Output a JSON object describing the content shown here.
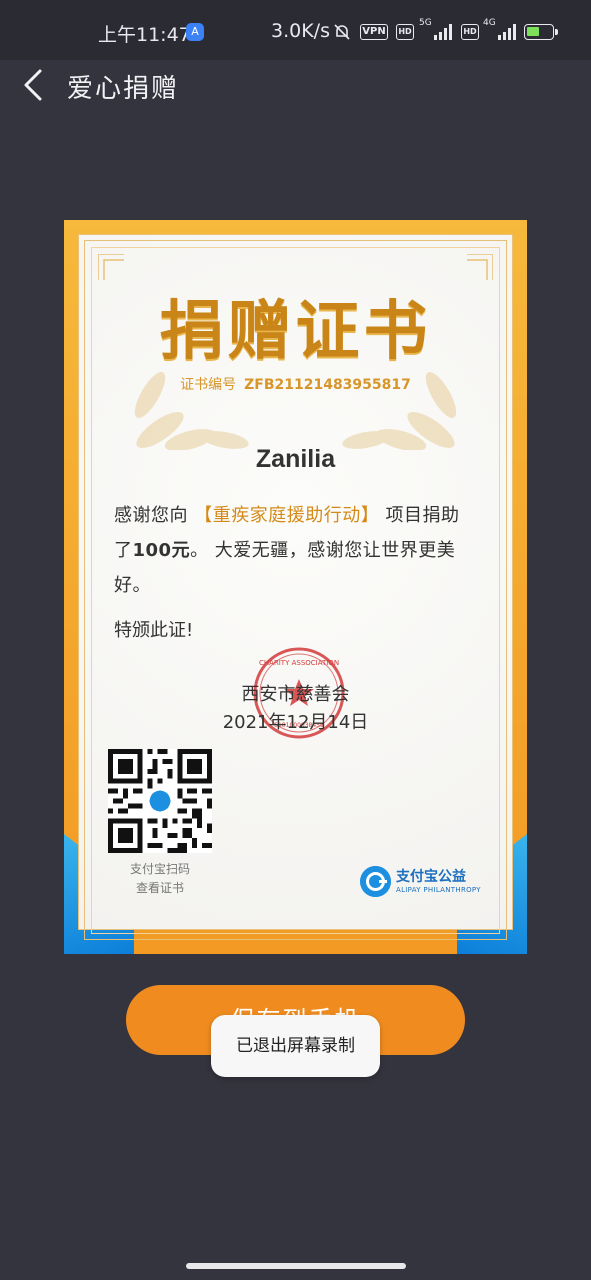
{
  "status_bar": {
    "time": "上午11:47",
    "app_badge": "A",
    "network_speed": "3.0K/s",
    "vpn": "VPN",
    "hd": "HD",
    "sig1": "5G",
    "sig2": "4G",
    "battery_level": 0.5
  },
  "header": {
    "title": "爱心捐赠",
    "back_icon": "chevron-left-icon"
  },
  "certificate": {
    "title": "捐赠证书",
    "number_label": "证书编号",
    "number": "ZFB21121483955817",
    "donor": "Zanilia",
    "body_prefix": "感谢您向",
    "project": "【重疾家庭援助行动】",
    "body_mid": "项目捐助了",
    "amount": "100元",
    "body_suffix": "。 大爱无疆，感谢您让世界更美好。",
    "special": "特颁此证!",
    "organization": "西安市慈善会",
    "date": "2021年12月14日",
    "qr_caption_line1": "支付宝扫码",
    "qr_caption_line2": "查看证书",
    "brand_name": "支付宝公益",
    "brand_sub": "ALIPAY PHILANTHROPY",
    "seal_text": "CHARITY ASSOCIATION",
    "seal_number": "6101000038459"
  },
  "actions": {
    "save_label": "保存到手机"
  },
  "toast": {
    "message": "已退出屏幕录制"
  },
  "colors": {
    "background": "#34343e",
    "accent": "#f08c1f",
    "gold": "#c98517",
    "alipay_blue": "#1c8fe0"
  }
}
